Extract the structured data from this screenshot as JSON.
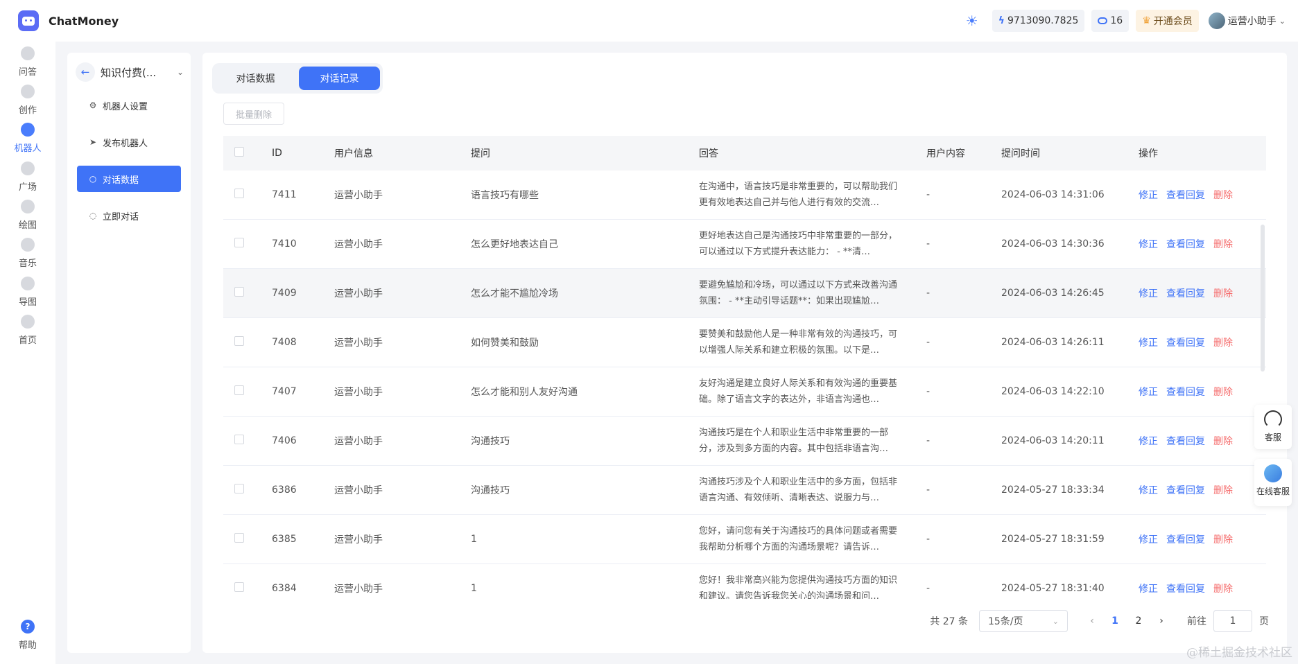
{
  "app": {
    "name": "ChatMoney"
  },
  "header": {
    "balance": "9713090.7825",
    "chat_count": "16",
    "vip_label": "开通会员",
    "user_name": "运营小助手"
  },
  "rail": {
    "items": [
      {
        "label": "问答",
        "icon": "qa-icon"
      },
      {
        "label": "创作",
        "icon": "pen-icon"
      },
      {
        "label": "机器人",
        "icon": "robot-icon"
      },
      {
        "label": "广场",
        "icon": "grid-icon"
      },
      {
        "label": "绘图",
        "icon": "palette-icon"
      },
      {
        "label": "音乐",
        "icon": "music-icon"
      },
      {
        "label": "导图",
        "icon": "mindmap-icon"
      },
      {
        "label": "首页",
        "icon": "home-icon"
      }
    ],
    "help_label": "帮助",
    "active_color": "#3f73f7"
  },
  "subnav": {
    "title": "知识付费(...",
    "items": [
      {
        "label": "机器人设置"
      },
      {
        "label": "发布机器人"
      },
      {
        "label": "对话数据"
      },
      {
        "label": "立即对话"
      }
    ]
  },
  "tabs": [
    {
      "label": "对话数据"
    },
    {
      "label": "对话记录"
    }
  ],
  "bulk_delete_label": "批量删除",
  "table": {
    "columns": [
      "ID",
      "用户信息",
      "提问",
      "回答",
      "用户内容",
      "提问时间",
      "操作"
    ],
    "actions": {
      "fix": "修正",
      "view": "查看回复",
      "delete": "删除"
    },
    "rows": [
      {
        "id": "7411",
        "user": "运营小助手",
        "question": "语言技巧有哪些",
        "answer": "在沟通中，语言技巧是非常重要的，可以帮助我们更有效地表达自己并与他人进行有效的交流…",
        "user_content": "-",
        "time": "2024-06-03 14:31:06"
      },
      {
        "id": "7410",
        "user": "运营小助手",
        "question": "怎么更好地表达自己",
        "answer": "更好地表达自己是沟通技巧中非常重要的一部分，可以通过以下方式提升表达能力： - **清…",
        "user_content": "-",
        "time": "2024-06-03 14:30:36"
      },
      {
        "id": "7409",
        "user": "运营小助手",
        "question": "怎么才能不尴尬冷场",
        "answer": "要避免尴尬和冷场，可以通过以下方式来改善沟通氛围： - **主动引导话题**：如果出现尴尬…",
        "user_content": "-",
        "time": "2024-06-03 14:26:45"
      },
      {
        "id": "7408",
        "user": "运营小助手",
        "question": "如何赞美和鼓励",
        "answer": "要赞美和鼓励他人是一种非常有效的沟通技巧，可以增强人际关系和建立积极的氛围。以下是…",
        "user_content": "-",
        "time": "2024-06-03 14:26:11"
      },
      {
        "id": "7407",
        "user": "运营小助手",
        "question": "怎么才能和别人友好沟通",
        "answer": "友好沟通是建立良好人际关系和有效沟通的重要基础。除了语言文字的表达外，非语言沟通也…",
        "user_content": "-",
        "time": "2024-06-03 14:22:10"
      },
      {
        "id": "7406",
        "user": "运营小助手",
        "question": "沟通技巧",
        "answer": "沟通技巧是在个人和职业生活中非常重要的一部分，涉及到多方面的内容。其中包括非语言沟…",
        "user_content": "-",
        "time": "2024-06-03 14:20:11"
      },
      {
        "id": "6386",
        "user": "运营小助手",
        "question": "沟通技巧",
        "answer": "沟通技巧涉及个人和职业生活中的多方面，包括非语言沟通、有效倾听、清晰表达、说服力与…",
        "user_content": "-",
        "time": "2024-05-27 18:33:34"
      },
      {
        "id": "6385",
        "user": "运营小助手",
        "question": "1",
        "answer": "您好，请问您有关于沟通技巧的具体问题或者需要我帮助分析哪个方面的沟通场景呢？请告诉…",
        "user_content": "-",
        "time": "2024-05-27 18:31:59"
      },
      {
        "id": "6384",
        "user": "运营小助手",
        "question": "1",
        "answer": "您好！我非常高兴能为您提供沟通技巧方面的知识和建议。请您告诉我您关心的沟通场景和问…",
        "user_content": "-",
        "time": "2024-05-27 18:31:40"
      }
    ]
  },
  "pagination": {
    "total": "共 27 条",
    "page_size": "15条/页",
    "pages": [
      "1",
      "2"
    ],
    "current": "1",
    "goto_label": "前往",
    "goto_value": "1",
    "page_suffix": "页"
  },
  "floating": {
    "service_label": "客服",
    "online_service_label": "在线客服"
  },
  "watermark": "@稀土掘金技术社区"
}
